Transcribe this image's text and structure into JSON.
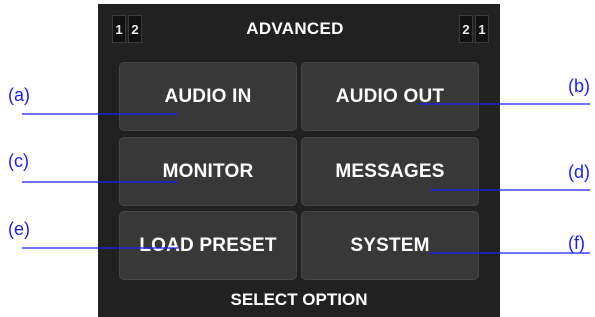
{
  "header": {
    "title": "ADVANCED",
    "left_indicator": [
      "1",
      "2"
    ],
    "right_indicator": [
      "2",
      "1"
    ]
  },
  "menu": {
    "audio_in": "AUDIO IN",
    "audio_out": "AUDIO OUT",
    "monitor": "MONITOR",
    "messages": "MESSAGES",
    "load_preset": "LOAD PRESET",
    "system": "SYSTEM"
  },
  "footer": {
    "text": "SELECT OPTION"
  },
  "callouts": {
    "a": "(a)",
    "b": "(b)",
    "c": "(c)",
    "d": "(d)",
    "e": "(e)",
    "f": "(f)"
  },
  "colors": {
    "screen_bg": "#212121",
    "button_bg": "#383838",
    "callout": "#1c1cff",
    "text": "#ffffff"
  }
}
